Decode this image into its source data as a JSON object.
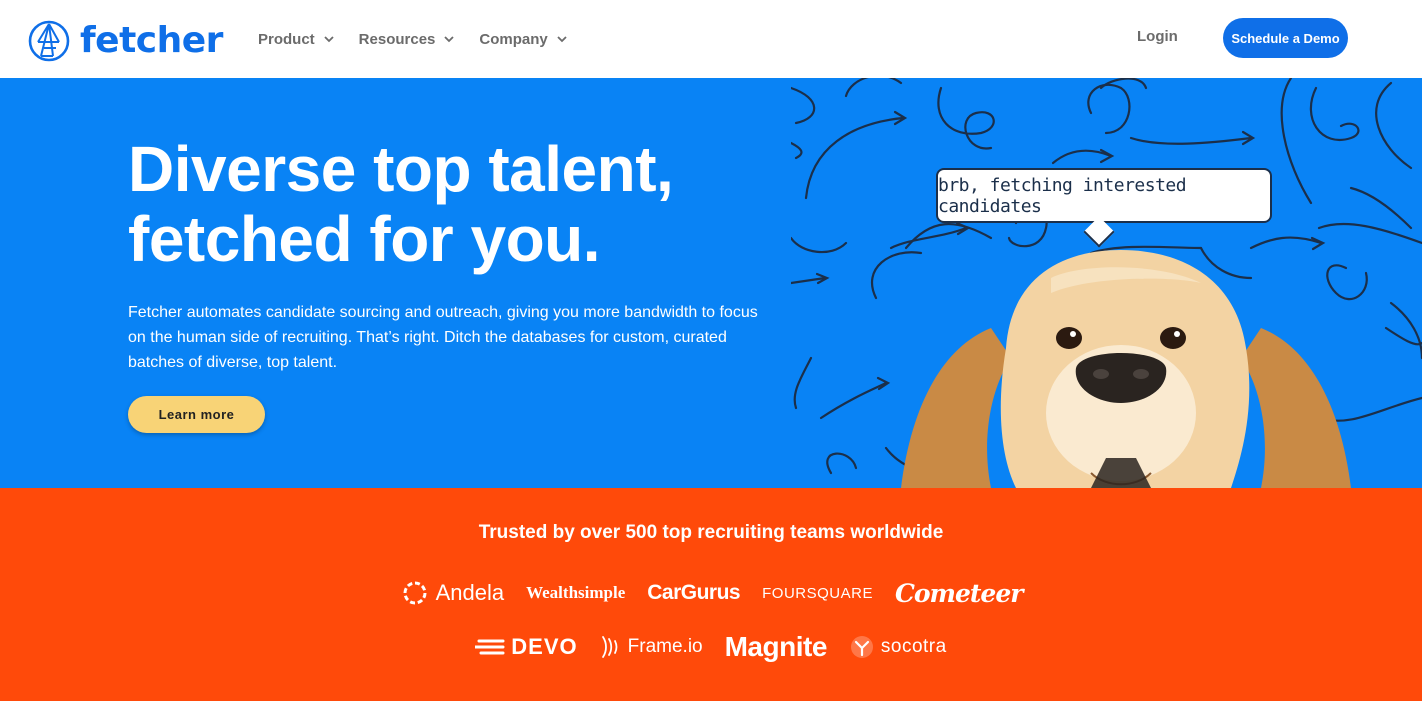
{
  "header": {
    "logo_text": "fetcher",
    "nav": [
      {
        "label": "Product"
      },
      {
        "label": "Resources"
      },
      {
        "label": "Company"
      }
    ],
    "login_label": "Login",
    "demo_label": "Schedule a Demo"
  },
  "hero": {
    "title_line1": "Diverse top talent,",
    "title_line2": "fetched for you.",
    "description": "Fetcher automates candidate sourcing and outreach, giving you more bandwidth to focus on the human side of recruiting. That’s right. Ditch the databases for custom, curated batches of diverse, top talent.",
    "cta_label": "Learn more",
    "bubble_text": "brb, fetching interested candidates"
  },
  "trusted": {
    "title": "Trusted by over 500 top recruiting teams worldwide",
    "logos": [
      "Andela",
      "Wealthsimple",
      "CarGurus",
      "FOURSQUARE",
      "Cometeer",
      "DEVO",
      "Frame.io",
      "Magnite",
      "socotra"
    ]
  },
  "colors": {
    "brand_blue": "#0f6fe8",
    "hero_blue": "#0983f5",
    "trusted_orange": "#ff4a0a",
    "cta_yellow": "#f8d376"
  },
  "icons": [
    "fetcher-logo-icon",
    "chevron-down-icon",
    "dog-illustration",
    "doodle-arrows"
  ]
}
